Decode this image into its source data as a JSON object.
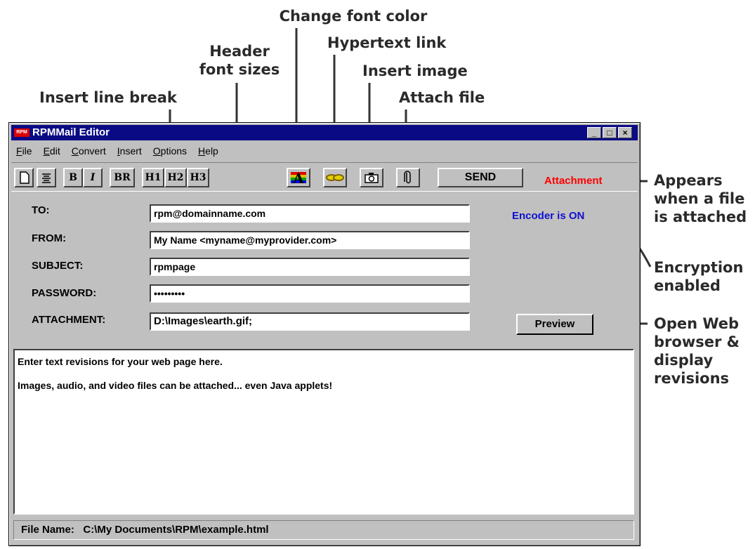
{
  "callouts": {
    "change_font_color": "Change font color",
    "hypertext_link": "Hypertext link",
    "header_font_sizes_1": "Header",
    "header_font_sizes_2": "font sizes",
    "insert_image": "Insert image",
    "insert_line_break": "Insert line break",
    "attach_file": "Attach file",
    "appears_1": "Appears",
    "appears_2": "when a file",
    "appears_3": "is attached",
    "encryption_1": "Encryption",
    "encryption_2": "enabled",
    "open_web_1": "Open Web",
    "open_web_2": "browser &",
    "open_web_3": "display",
    "open_web_4": "revisions"
  },
  "window": {
    "title": "RPMMail Editor",
    "icon_text": "RPM",
    "minimize": "_",
    "maximize": "□",
    "close": "×"
  },
  "menu": [
    "File",
    "Edit",
    "Convert",
    "Insert",
    "Options",
    "Help"
  ],
  "toolbar": {
    "bold": "B",
    "italic": "I",
    "br": "BR",
    "h1": "H1",
    "h2": "H2",
    "h3": "H3",
    "font_color": "A",
    "send": "SEND",
    "attachment_indicator": "Attachment"
  },
  "form": {
    "to_label": "TO:",
    "to_value": "rpm@domainname.com",
    "from_label": "FROM:",
    "from_value": "My Name <myname@myprovider.com>",
    "subject_label": "SUBJECT:",
    "subject_value": "rpmpage",
    "password_label": "PASSWORD:",
    "password_value": "•••••••••",
    "attachment_label": "ATTACHMENT:",
    "attachment_value": "D:\\Images\\earth.gif;",
    "encoder_status": "Encoder is ON",
    "preview": "Preview"
  },
  "body": {
    "line1": "Enter text revisions for your web page here.",
    "line2": "Images, audio, and video files can be attached... even Java applets!"
  },
  "status": {
    "file_name": "File Name:   C:\\My Documents\\RPM\\example.html"
  },
  "colors": {
    "title_bar": "#0a0a84",
    "attachment": "#ff0000",
    "encoder": "#1010d0",
    "callout_text": "#2a2a2a"
  }
}
